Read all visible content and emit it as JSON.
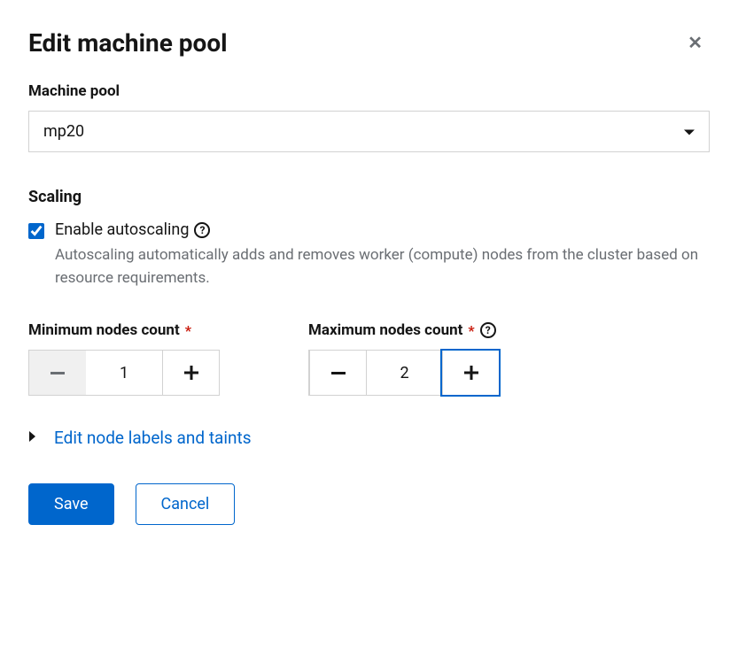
{
  "modal": {
    "title": "Edit machine pool"
  },
  "machinePool": {
    "label": "Machine pool",
    "selected": "mp20"
  },
  "scaling": {
    "heading": "Scaling",
    "checkbox_label": "Enable autoscaling",
    "description": "Autoscaling automatically adds and removes worker (compute) nodes from the cluster based on resource requirements."
  },
  "minNodes": {
    "label": "Minimum nodes count",
    "value": "1"
  },
  "maxNodes": {
    "label": "Maximum nodes count",
    "value": "2"
  },
  "expand": {
    "label": "Edit node labels and taints"
  },
  "buttons": {
    "save": "Save",
    "cancel": "Cancel"
  }
}
